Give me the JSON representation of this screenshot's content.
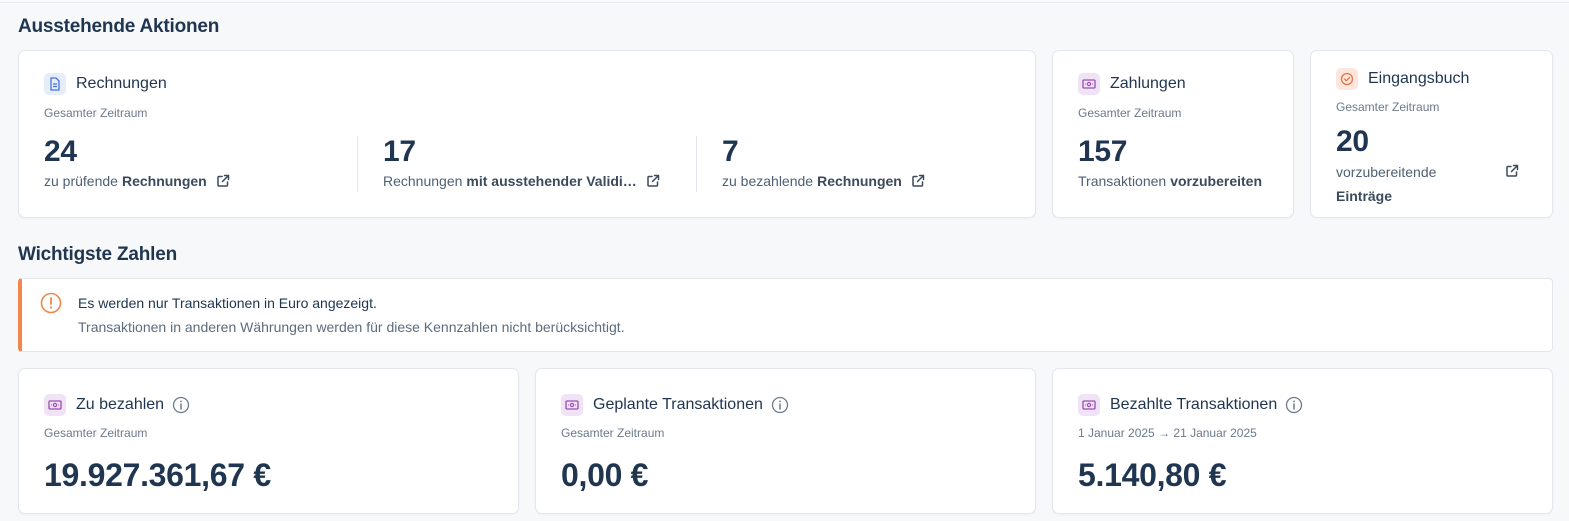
{
  "sections": {
    "pending_title": "Ausstehende Aktionen",
    "figures_title": "Wichtigste Zahlen"
  },
  "invoices_card": {
    "title": "Rechnungen",
    "period": "Gesamter Zeitraum",
    "items": [
      {
        "value": "24",
        "text": "zu prüfende",
        "bold": "Rechnungen"
      },
      {
        "value": "17",
        "text": "Rechnungen",
        "bold": "mit ausstehender Validi…"
      },
      {
        "value": "7",
        "text": "zu bezahlende",
        "bold": "Rechnungen"
      }
    ]
  },
  "payments_card": {
    "title": "Zahlungen",
    "period": "Gesamter Zeitraum",
    "value": "157",
    "text": "Transaktionen",
    "bold": "vorzubereiten"
  },
  "inbox_card": {
    "title": "Eingangsbuch",
    "period": "Gesamter Zeitraum",
    "value": "20",
    "text": "vorzubereitende",
    "bold": "Einträge"
  },
  "alert": {
    "title": "Es werden nur Transaktionen in Euro angezeigt.",
    "text": "Transaktionen in anderen Währungen werden für diese Kennzahlen nicht berücksichtigt."
  },
  "kpis": [
    {
      "title": "Zu bezahlen",
      "period": "Gesamter Zeitraum",
      "amount": "19.927.361,67 €"
    },
    {
      "title": "Geplante Transaktionen",
      "period": "Gesamter Zeitraum",
      "amount": "0,00 €"
    },
    {
      "title": "Bezahlte Transaktionen",
      "period": "1 Januar 2025 → 21 Januar 2025",
      "amount": "5.140,80 €"
    }
  ],
  "colors": {
    "accent_orange": "#f0874a",
    "text_dark": "#1f3550",
    "chip_blue": "#e5edfb",
    "chip_purple": "#f1e3f6",
    "chip_orange": "#fde6dc"
  }
}
